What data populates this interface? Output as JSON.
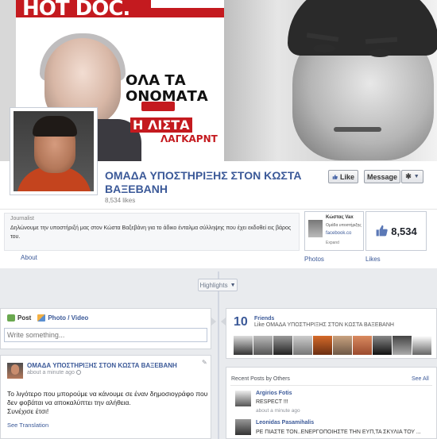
{
  "cover": {
    "magazine_logo": "HOT DOC.",
    "headline_line1": "ΟΛΑ ΤΑ",
    "headline_line2": "ΟΝΟΜΑΤΑ",
    "headline_list": "Η ΛΙΣΤΑ",
    "headline_name": "ΛΑΓΚΑΡΝΤ"
  },
  "page": {
    "title": "ΟΜΑΔΑ ΥΠΟΣΤΗΡΙΞΗΣ ΣΤΟΝ ΚΩΣΤΑ ΒΑΞΕΒΑΝΗ",
    "likes_text": "8,534 likes"
  },
  "actions": {
    "like_label": "Like",
    "message_label": "Message"
  },
  "about": {
    "category": "Journalist",
    "description": "Δηλώνουμε την υποστήριξή μας στον Κώστα Βαξεβάνη για το άδικο ένταλμα σύλληψης που έχει εκδοθεί εις βάρος του.",
    "link_label": "About"
  },
  "apps": {
    "photos_label": "Photos",
    "photos_thumb_line1": "Κώστας Vax",
    "photos_thumb_line2": "Ομάδα υποστήριξης",
    "photos_thumb_line3": "facebook.co",
    "photos_thumb_line4": "Expand",
    "likes_count": "8,534",
    "likes_label": "Likes"
  },
  "timeline": {
    "highlights_label": "Highlights"
  },
  "composer": {
    "tab_post": "Post",
    "tab_photo": "Photo / Video",
    "placeholder": "Write something..."
  },
  "post": {
    "author": "ΟΜΑΔΑ ΥΠΟΣΤΗΡΙΞΗΣ ΣΤΟΝ ΚΩΣΤΑ ΒΑΞΕΒΑΝΗ",
    "time": "about a minute ago",
    "text_line1": "Το λιγότερο που μπορούμε να κάνουμε σε έναν δημοσιογράφο που",
    "text_line2": "δεν φοβάται να αποκαλύπτει την αλήθεια.",
    "text_line3": "Συνέχισε έτσι!",
    "translate_label": "See Translation"
  },
  "friends": {
    "count": "10",
    "title": "Friends",
    "subtitle": "Like ΟΜΑΔΑ ΥΠΟΣΤΗΡΙΞΗΣ ΣΤΟΝ ΚΩΣΤΑ ΒΑΞΕΒΑΝΗ"
  },
  "recent_posts": {
    "title": "Recent Posts by Others",
    "see_all": "See All",
    "items": [
      {
        "name": "Argirios Fotis",
        "text": "RESPECT !!!",
        "time": "about a minute ago"
      },
      {
        "name": "Leonidas Pasamihalis",
        "text": "ΡΕ ΠΙΑΣΤΕ ΤΟΝ..ΕΝΕΡΓΟΠΟΙΗΣΤΕ ΤΗΝ ΕΥΠ,ΤΑ ΣΚΥΛΙΑ ΤΟΥ ...",
        "time": ""
      }
    ]
  },
  "icons": {
    "like": "thumbs-up-icon",
    "gear": "gear-icon",
    "post": "status-icon",
    "photo": "photo-icon",
    "globe": "globe-icon"
  },
  "colors": {
    "brand_blue": "#3b5998",
    "background": "#e9ebee",
    "magazine_red": "#c41a1f"
  }
}
